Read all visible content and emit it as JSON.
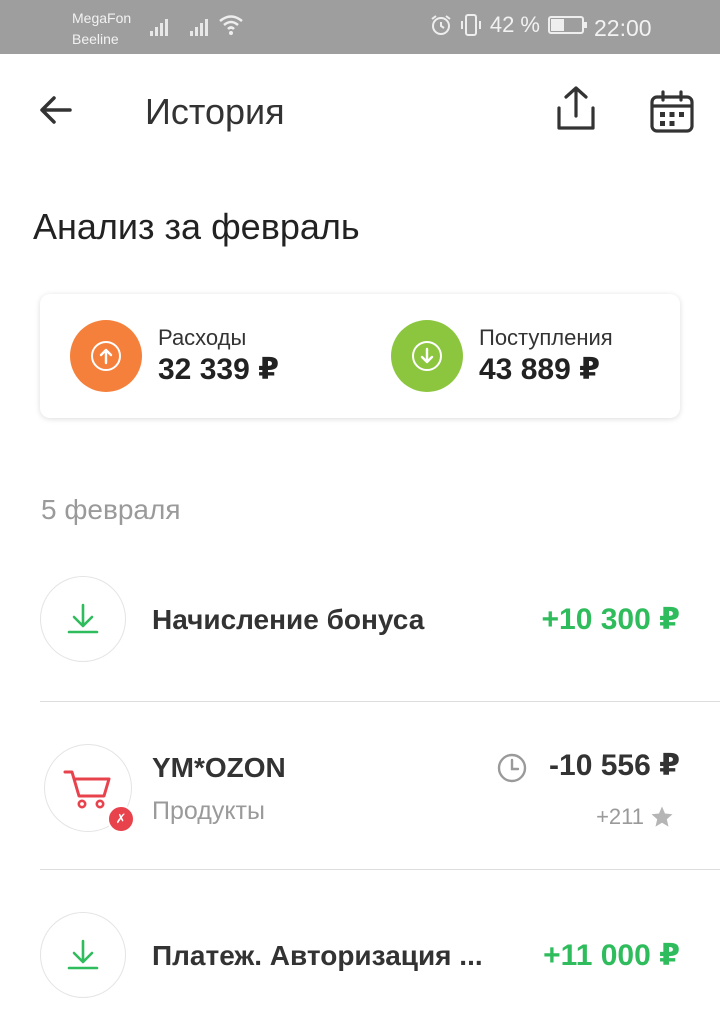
{
  "status_bar": {
    "carrier_1": "MegaFon",
    "carrier_2": "Beeline",
    "battery": "42 %",
    "time": "22:00",
    "icons": [
      "signal-icon",
      "signal-icon",
      "wifi-icon",
      "alarm-icon",
      "vibrate-icon",
      "battery-icon"
    ]
  },
  "header": {
    "title": "История",
    "back_icon": "arrow-left-icon",
    "share_icon": "share-icon",
    "calendar_icon": "calendar-icon"
  },
  "analysis": {
    "title": "Анализ за февраль",
    "expenses": {
      "label": "Расходы",
      "value": "32 339 ₽",
      "color": "#f5803b"
    },
    "income": {
      "label": "Поступления",
      "value": "43 889 ₽",
      "color": "#8cc63f"
    }
  },
  "history": {
    "date": "5 февраля",
    "transactions": [
      {
        "name": "Начисление бонуса",
        "amount": "+10 300 ₽",
        "type": "income",
        "icon": "download-icon"
      },
      {
        "name": "YM*OZON",
        "category": "Продукты",
        "amount": "-10 556 ₽",
        "bonus": "+211",
        "type": "expense",
        "icon": "cart-icon",
        "pending_icon": "clock-icon",
        "bonus_icon": "star-icon"
      },
      {
        "name": "Платеж. Авторизация ...",
        "amount": "+11 000 ₽",
        "type": "income",
        "icon": "download-icon"
      }
    ]
  },
  "colors": {
    "positive": "#2fbc5c",
    "accent_red": "#e8434d",
    "status_bar": "#9e9e9e"
  }
}
